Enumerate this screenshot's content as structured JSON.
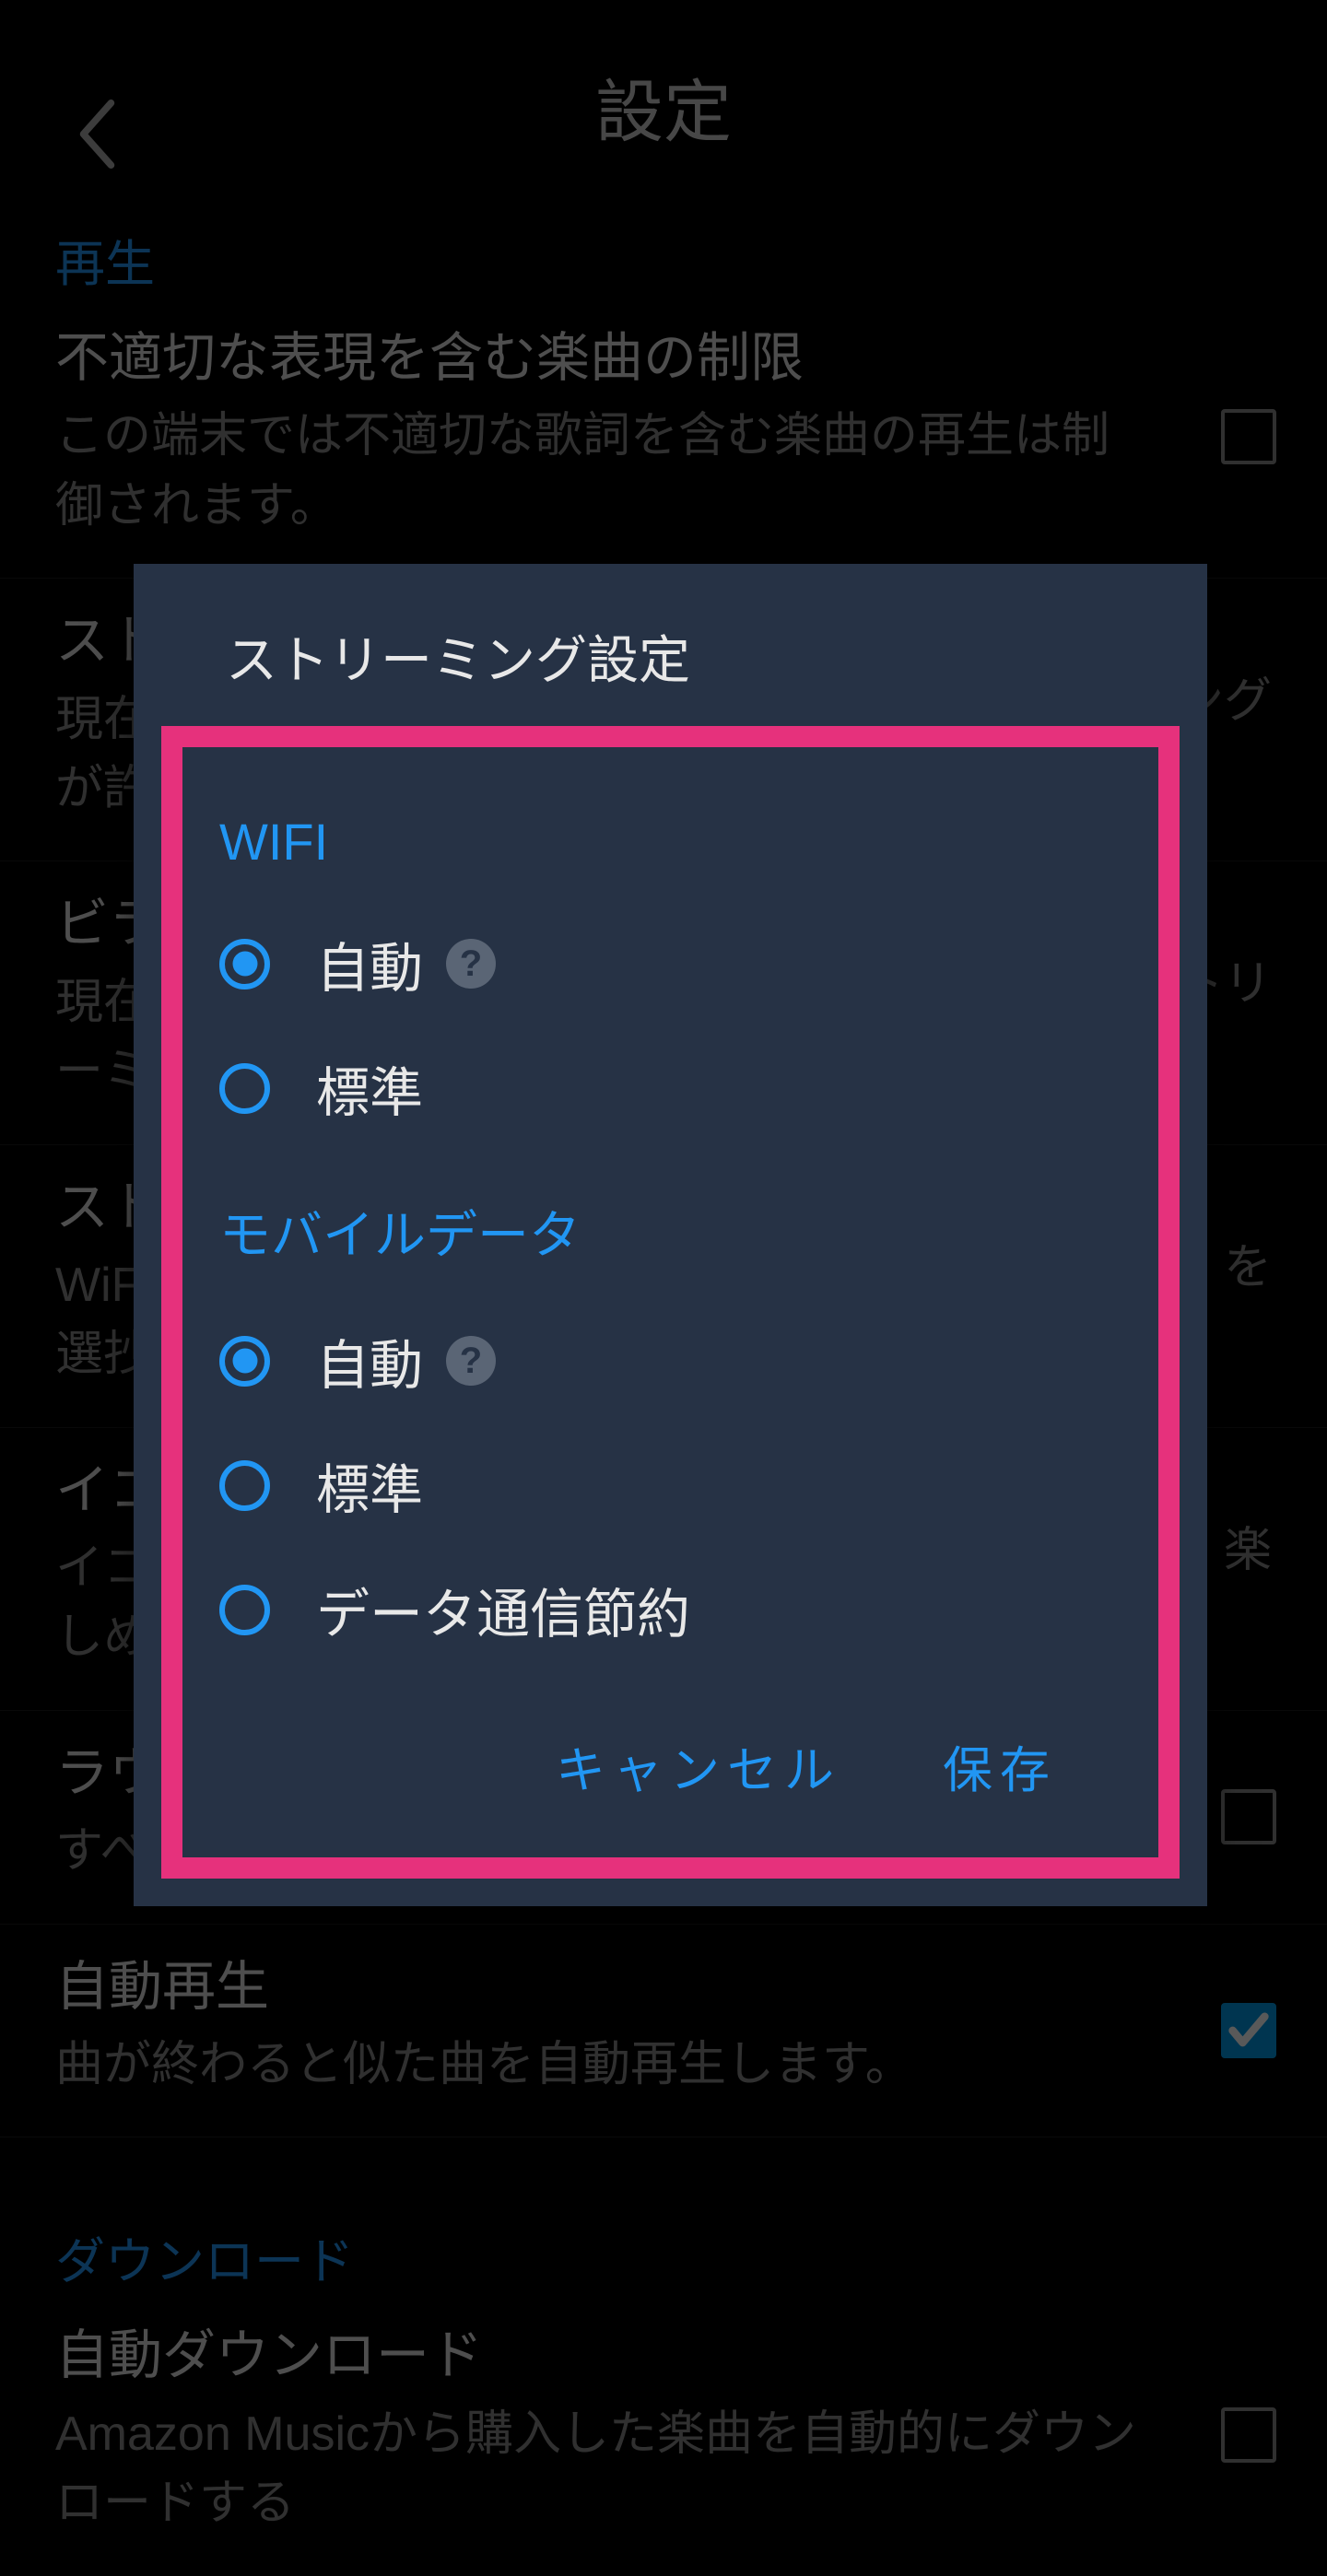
{
  "header": {
    "title": "設定"
  },
  "playback_section_header": "再生",
  "rows": {
    "explicit": {
      "title": "不適切な表現を含む楽曲の制限",
      "desc": "この端末では不適切な歌詞を含む楽曲の再生は制御されます。",
      "checked": false
    },
    "streaming": {
      "title": "スト",
      "desc": "現在\nが許",
      "trail": "ング"
    },
    "video": {
      "title": "ビラ",
      "desc": "現在\nーミ",
      "trail": "トリ"
    },
    "network": {
      "title": "スト",
      "desc": "WiF\n選抄",
      "trail": "を"
    },
    "equalizer": {
      "title": "イコ",
      "desc": "イコ\nしめ",
      "trail": "楽"
    },
    "loudness": {
      "title": "ラウ",
      "desc": "すべ",
      "checked": false
    },
    "autoplay": {
      "title": "自動再生",
      "desc": "曲が終わると似た曲を自動再生します。",
      "checked": true
    },
    "autodownload": {
      "title": "自動ダウンロード",
      "desc": "Amazon Musicから購入した楽曲を自動的にダウンロードする",
      "checked": false
    }
  },
  "download_section_header": "ダウンロード",
  "dialog": {
    "title": "ストリーミング設定",
    "sections": {
      "wifi": {
        "label": "WIFI",
        "options": [
          "自動",
          "標準"
        ],
        "selected": 0,
        "help_on": [
          0
        ]
      },
      "mobile": {
        "label": "モバイルデータ",
        "options": [
          "自動",
          "標準",
          "データ通信節約"
        ],
        "selected": 0,
        "help_on": [
          0
        ]
      }
    },
    "cancel": "キャンセル",
    "save": "保存"
  }
}
